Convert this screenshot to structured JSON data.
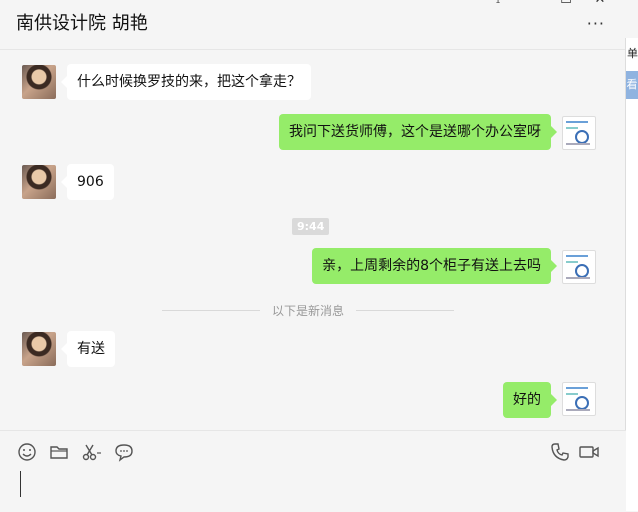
{
  "header": {
    "title": "南供设计院 胡艳"
  },
  "window_controls": {
    "pin": "⟟",
    "minimize": "—",
    "maximize": "☐",
    "close": "✕"
  },
  "more_label": "···",
  "right_strip": {
    "char1": "单",
    "char2": "看"
  },
  "messages": [
    {
      "side": "in",
      "text": "什么时候换罗技的来，把这个拿走？"
    },
    {
      "side": "out",
      "text": "我问下送货师傅，这个是送哪个办公室呀"
    },
    {
      "side": "in",
      "text": "906"
    },
    {
      "side": "out",
      "text": "亲，上周剩余的8个柜子有送上去吗"
    },
    {
      "side": "in",
      "text": "有送"
    },
    {
      "side": "out",
      "text": "好的"
    }
  ],
  "timestamp": "9:44",
  "new_messages_divider": "以下是新消息",
  "toolbar": {
    "icons": [
      "emoji-icon",
      "folder-icon",
      "scissors-icon",
      "chat-bubble-icon",
      "phone-icon",
      "video-icon"
    ]
  }
}
